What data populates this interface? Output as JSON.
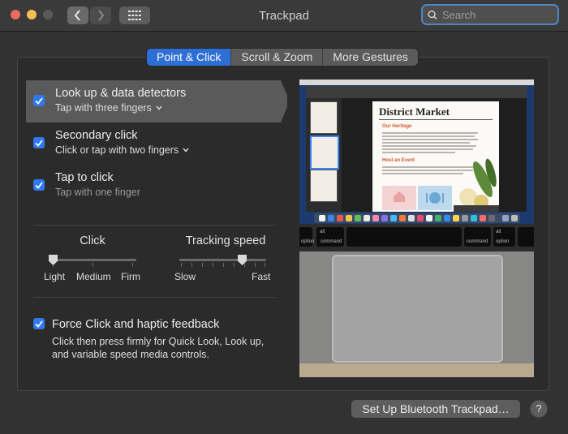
{
  "window": {
    "title": "Trackpad",
    "search_placeholder": "Search"
  },
  "tabs": [
    {
      "label": "Point & Click",
      "active": true
    },
    {
      "label": "Scroll & Zoom",
      "active": false
    },
    {
      "label": "More Gestures",
      "active": false
    }
  ],
  "options": {
    "lookup": {
      "title": "Look up & data detectors",
      "subtitle": "Tap with three fingers",
      "checked": true
    },
    "secondary": {
      "title": "Secondary click",
      "subtitle": "Click or tap with two fingers",
      "checked": true
    },
    "tap": {
      "title": "Tap to click",
      "subtitle": "Tap with one finger",
      "checked": true
    }
  },
  "click_slider": {
    "title": "Click",
    "labels": [
      "Light",
      "Medium",
      "Firm"
    ],
    "value": 0
  },
  "tracking_slider": {
    "title": "Tracking speed",
    "min_label": "Slow",
    "max_label": "Fast",
    "value": 0.75
  },
  "force_click": {
    "title": "Force Click and haptic feedback",
    "description": "Click then press firmly for Quick Look, Look up, and variable speed media controls.",
    "checked": true
  },
  "preview": {
    "document_title": "District Market",
    "heading_1": "Our Heritage",
    "heading_2": "Host an Event",
    "keys": {
      "option_left": "option",
      "alt_left": "alt",
      "command_left": "command",
      "command_right": "command",
      "alt_right": "alt",
      "option_right": "option"
    }
  },
  "footer": {
    "bluetooth_button": "Set Up Bluetooth Trackpad…",
    "help": "?"
  },
  "colors": {
    "accent": "#2e6fd6",
    "checkbox": "#2f78f0",
    "close": "#ed6a5e",
    "minimize": "#f5bf4f"
  }
}
